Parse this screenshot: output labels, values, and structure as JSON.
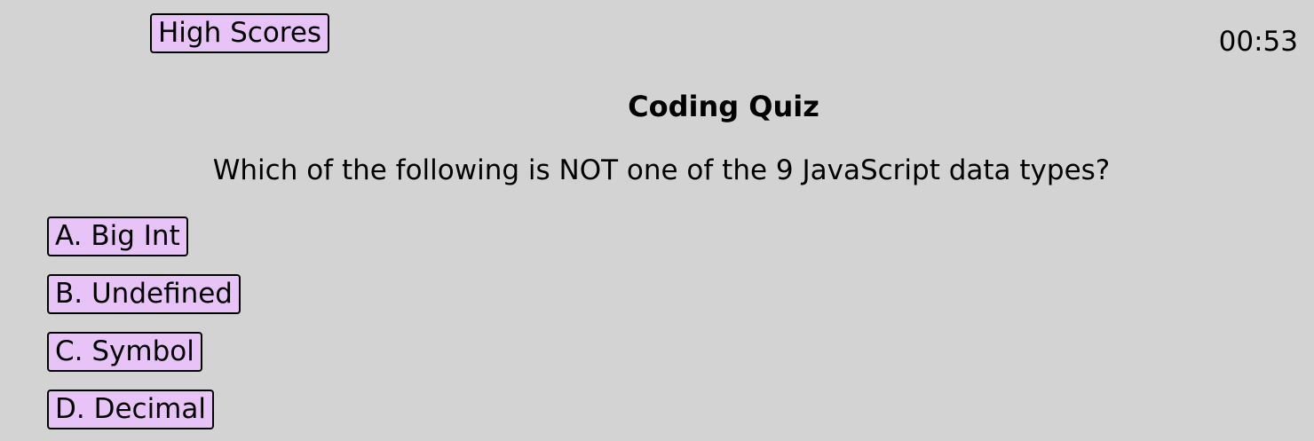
{
  "header": {
    "high_scores_label": "High Scores",
    "timer": "00:53"
  },
  "quiz": {
    "title": "Coding Quiz",
    "question": "Which of the following is NOT one of the 9 JavaScript data types?",
    "answers": [
      {
        "label": "A. Big Int"
      },
      {
        "label": "B. Undefined"
      },
      {
        "label": "C. Symbol"
      },
      {
        "label": "D. Decimal"
      }
    ]
  },
  "colors": {
    "background": "#d3d3d3",
    "button_fill": "#e8c3f7",
    "button_border": "#000000"
  }
}
